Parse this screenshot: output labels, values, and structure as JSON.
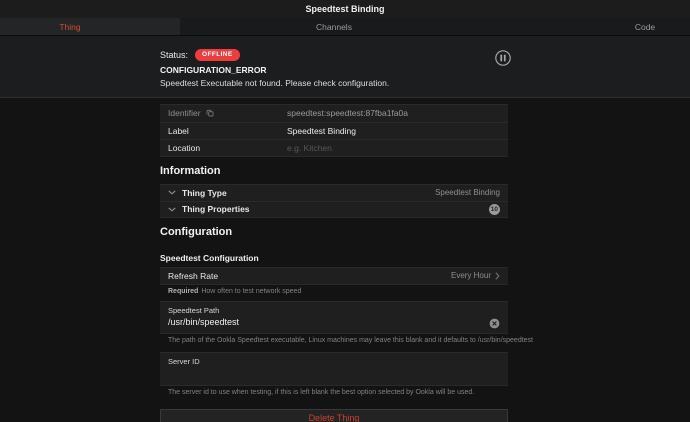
{
  "navbar": {
    "title": "Speedtest Binding"
  },
  "tabs": [
    {
      "label": "Thing",
      "active": true
    },
    {
      "label": "Channels",
      "active": false
    },
    {
      "label": "Code",
      "active": false
    }
  ],
  "status": {
    "label": "Status:",
    "badge": "OFFLINE",
    "error_code": "CONFIGURATION_ERROR",
    "error_message": "Speedtest Executable not found. Please check configuration.",
    "pause_icon": "pause-circle"
  },
  "fields": {
    "identifier": {
      "label": "Identifier",
      "value": "speedtest:speedtest:87fba1fa0a",
      "copy_icon": "copy"
    },
    "label": {
      "label": "Label",
      "value": "Speedtest Binding"
    },
    "location": {
      "label": "Location",
      "placeholder": "e.g. Kitchen"
    }
  },
  "information": {
    "heading": "Information",
    "rows": [
      {
        "label": "Thing Type",
        "value": "Speedtest Binding"
      },
      {
        "label": "Thing Properties",
        "badge": "10"
      }
    ]
  },
  "configuration": {
    "heading": "Configuration",
    "subheading": "Speedtest Configuration",
    "refresh_rate": {
      "label": "Refresh Rate",
      "value": "Every Hour",
      "helper_bold": "Required",
      "helper": "How often to test network speed"
    },
    "speedtest_path": {
      "label": "Speedtest Path",
      "value": "/usr/bin/speedtest",
      "helper": "The path of the Ookla Speedtest executable, Linux machines may leave this blank and it defaults to /usr/bin/speedtest"
    },
    "server_id": {
      "label": "Server ID",
      "value": "",
      "helper": "The server id to use when testing, if this is left blank the best option selected by Ookla will be used."
    }
  },
  "actions": {
    "delete_label": "Delete Thing"
  },
  "colors": {
    "accent": "#cf4f35",
    "status_red": "#ec3e3e",
    "card_bg": "#1f1f20",
    "page_bg": "#131314"
  }
}
